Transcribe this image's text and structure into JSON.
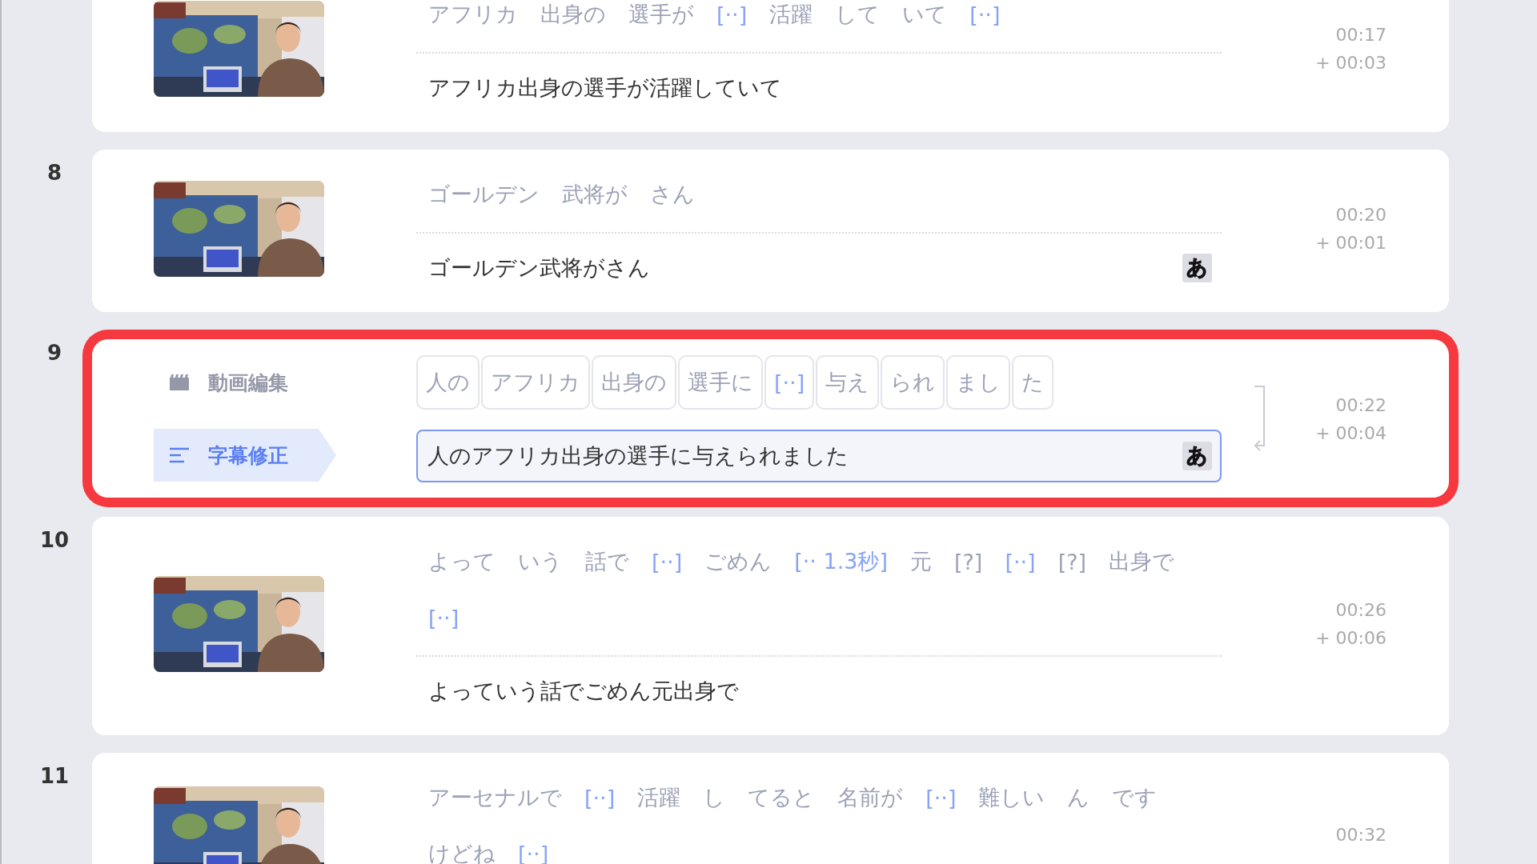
{
  "rows": [
    {
      "kind": "view",
      "token_lines": [
        [
          {
            "text": "アフリカ",
            "kind": "word"
          },
          {
            "text": "出身の",
            "kind": "word"
          },
          {
            "text": "選手が",
            "kind": "word"
          },
          {
            "text": "[··]",
            "kind": "gap"
          },
          {
            "text": "活躍",
            "kind": "word"
          },
          {
            "text": "して",
            "kind": "word"
          },
          {
            "text": "いて",
            "kind": "word"
          },
          {
            "text": "[··]",
            "kind": "gap"
          }
        ]
      ],
      "text": "アフリカ出身の選手が活躍していて",
      "start": "00:17",
      "duration": "+ 00:03"
    },
    {
      "kind": "view",
      "number": "8",
      "token_lines": [
        [
          {
            "text": "ゴールデン",
            "kind": "word"
          },
          {
            "text": "武将が",
            "kind": "word"
          },
          {
            "text": "さん",
            "kind": "word"
          }
        ]
      ],
      "text": "ゴールデン武将がさん",
      "kana": "あ",
      "start": "00:20",
      "duration": "+ 00:01"
    },
    {
      "kind": "edit",
      "number": "9",
      "menu": [
        {
          "label": "動画編集",
          "selected": false
        },
        {
          "label": "字幕修正",
          "selected": true
        }
      ],
      "chips": [
        {
          "text": "人の",
          "kind": "word"
        },
        {
          "text": "アフリカ",
          "kind": "word"
        },
        {
          "text": "出身の",
          "kind": "word"
        },
        {
          "text": "選手に",
          "kind": "word"
        },
        {
          "text": "[··]",
          "kind": "gap"
        },
        {
          "text": "与え",
          "kind": "word"
        },
        {
          "text": "られ",
          "kind": "word"
        },
        {
          "text": "まし",
          "kind": "word"
        },
        {
          "text": "た",
          "kind": "word"
        }
      ],
      "value": "人のアフリカ出身の選手に与えられました",
      "kana": "あ",
      "start": "00:22",
      "duration": "+ 00:04"
    },
    {
      "kind": "view",
      "number": "10",
      "token_lines": [
        [
          {
            "text": "よって",
            "kind": "word"
          },
          {
            "text": "いう",
            "kind": "word"
          },
          {
            "text": "話で",
            "kind": "word"
          },
          {
            "text": "[··]",
            "kind": "gap"
          },
          {
            "text": "ごめん",
            "kind": "word"
          },
          {
            "text": "[·· 1.3秒]",
            "kind": "gap"
          },
          {
            "text": "元",
            "kind": "word"
          },
          {
            "text": "[?]",
            "kind": "unknown"
          },
          {
            "text": "[··]",
            "kind": "gap"
          },
          {
            "text": "[?]",
            "kind": "unknown"
          },
          {
            "text": "出身で",
            "kind": "word"
          }
        ],
        [
          {
            "text": "[··]",
            "kind": "gap"
          }
        ]
      ],
      "text": "よっていう話でごめん元出身で",
      "start": "00:26",
      "duration": "+ 00:06"
    },
    {
      "kind": "view",
      "number": "11",
      "token_lines": [
        [
          {
            "text": "アーセナルで",
            "kind": "word"
          },
          {
            "text": "[··]",
            "kind": "gap"
          },
          {
            "text": "活躍",
            "kind": "word"
          },
          {
            "text": "し",
            "kind": "word"
          },
          {
            "text": "てると",
            "kind": "word"
          },
          {
            "text": "名前が",
            "kind": "word"
          },
          {
            "text": "[··]",
            "kind": "gap"
          },
          {
            "text": "難しい",
            "kind": "word"
          },
          {
            "text": "ん",
            "kind": "word"
          },
          {
            "text": "です",
            "kind": "word"
          }
        ],
        [
          {
            "text": "けどね",
            "kind": "word"
          },
          {
            "text": "[··]",
            "kind": "gap"
          }
        ]
      ],
      "start": "00:32"
    }
  ]
}
